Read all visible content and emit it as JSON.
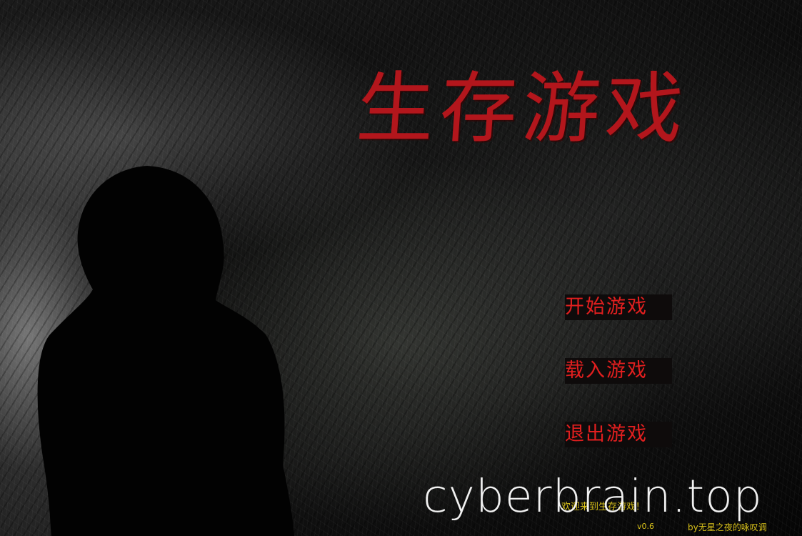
{
  "game": {
    "title": "生存游戏"
  },
  "menu": {
    "items": [
      {
        "label": "开始游戏"
      },
      {
        "label": "载入游戏"
      },
      {
        "label": "退出游戏"
      }
    ]
  },
  "footer": {
    "welcome": "欢迎来到生存游戏！",
    "version": "v0.6",
    "author": "by无星之夜的咏叹调"
  },
  "watermark": "cyberbrain.top",
  "colors": {
    "title": "#b3161c",
    "menu_text": "#e21f1f",
    "footer_text": "#d8c11a"
  }
}
